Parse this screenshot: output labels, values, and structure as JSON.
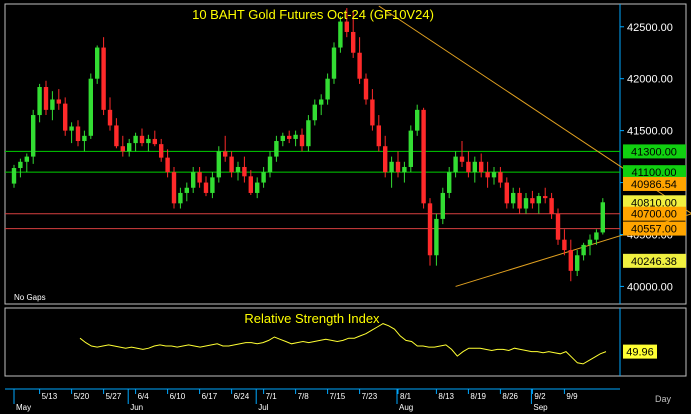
{
  "colors": {
    "background": "#000000",
    "panel_border": "#c0c0c0",
    "axis_blue": "#00a8ff",
    "title": "#ffff00",
    "bull": "#33dd33",
    "bear": "#ff2a2a",
    "trend": "#e0a020",
    "green_level": "#00d000",
    "red_level": "#d84040",
    "rsi_line": "#ffff33",
    "tag_green": "#10d010",
    "tag_orange": "#ffa500",
    "tag_yellow": "#f0f040"
  },
  "chart_data": [
    {
      "type": "candlestick",
      "title": "10  BAHT  Gold  Futures  Oct-24  (GF10V24)",
      "note": "No  Gaps",
      "ylim": [
        39850,
        42700
      ],
      "yticks": [
        40000,
        40500,
        41000,
        41500,
        42000,
        42500
      ],
      "ytick_labels": [
        "40000.00",
        "40500.00",
        "41000.00",
        "41500.00",
        "42000.00",
        "42500.00"
      ],
      "levels": [
        {
          "value": 41300,
          "label": "41300.00",
          "tag": "green",
          "line": "green_level"
        },
        {
          "value": 41100,
          "label": "41100.00",
          "tag": "green",
          "line": "green_level"
        },
        {
          "value": 40986.54,
          "label": "40986.54",
          "tag": "orange",
          "line": null
        },
        {
          "value": 40810,
          "label": "40810.00",
          "tag": "yellow",
          "line": null
        },
        {
          "value": 40700,
          "label": "40700.00",
          "tag": "orange",
          "line": "red_level"
        },
        {
          "value": 40557,
          "label": "40557.00",
          "tag": "orange",
          "line": "red_level"
        },
        {
          "value": 40246.38,
          "label": "40246.38",
          "tag": "yellow",
          "line": null
        }
      ],
      "trendlines": [
        {
          "from": [
            57,
            42700
          ],
          "to": [
            112,
            40450
          ]
        },
        {
          "from": [
            69,
            40000
          ],
          "to": [
            121,
            40986
          ]
        }
      ],
      "candles": [
        [
          40990,
          41170,
          40950,
          41140
        ],
        [
          41140,
          41230,
          41050,
          41200
        ],
        [
          41200,
          41280,
          41100,
          41250
        ],
        [
          41250,
          41700,
          41180,
          41650
        ],
        [
          41650,
          41950,
          41580,
          41920
        ],
        [
          41920,
          41980,
          41650,
          41700
        ],
        [
          41700,
          41880,
          41600,
          41800
        ],
        [
          41800,
          41900,
          41700,
          41760
        ],
        [
          41760,
          41820,
          41450,
          41500
        ],
        [
          41500,
          41580,
          41380,
          41540
        ],
        [
          41540,
          41600,
          41350,
          41400
        ],
        [
          41400,
          41500,
          41300,
          41450
        ],
        [
          41450,
          42050,
          41420,
          42000
        ],
        [
          42000,
          42320,
          41950,
          42300
        ],
        [
          42300,
          42400,
          41650,
          41700
        ],
        [
          41700,
          41820,
          41500,
          41550
        ],
        [
          41550,
          41620,
          41330,
          41350
        ],
        [
          41350,
          41450,
          41250,
          41300
        ],
        [
          41300,
          41420,
          41250,
          41380
        ],
        [
          41380,
          41480,
          41300,
          41450
        ],
        [
          41450,
          41520,
          41350,
          41380
        ],
        [
          41380,
          41460,
          41300,
          41420
        ],
        [
          41420,
          41500,
          41350,
          41370
        ],
        [
          41370,
          41420,
          41200,
          41240
        ],
        [
          41240,
          41320,
          41050,
          41100
        ],
        [
          41100,
          41150,
          40750,
          40800
        ],
        [
          40800,
          40950,
          40750,
          40900
        ],
        [
          40900,
          41000,
          40820,
          40950
        ],
        [
          40950,
          41150,
          40900,
          41100
        ],
        [
          41100,
          41150,
          40950,
          41000
        ],
        [
          41000,
          41060,
          40870,
          40900
        ],
        [
          40900,
          41100,
          40850,
          41050
        ],
        [
          41050,
          41350,
          41000,
          41300
        ],
        [
          41300,
          41450,
          41200,
          41250
        ],
        [
          41250,
          41300,
          41050,
          41100
        ],
        [
          41100,
          41200,
          41020,
          41150
        ],
        [
          41150,
          41250,
          41000,
          41060
        ],
        [
          41060,
          41120,
          40880,
          40900
        ],
        [
          40900,
          41050,
          40850,
          41000
        ],
        [
          41000,
          41150,
          40950,
          41100
        ],
        [
          41100,
          41300,
          41050,
          41250
        ],
        [
          41250,
          41450,
          41200,
          41400
        ],
        [
          41400,
          41480,
          41350,
          41450
        ],
        [
          41450,
          41500,
          41380,
          41420
        ],
        [
          41420,
          41500,
          41350,
          41460
        ],
        [
          41460,
          41520,
          41300,
          41350
        ],
        [
          41350,
          41650,
          41300,
          41600
        ],
        [
          41600,
          41800,
          41550,
          41750
        ],
        [
          41750,
          41850,
          41650,
          41800
        ],
        [
          41800,
          42050,
          41750,
          42000
        ],
        [
          42000,
          42350,
          41950,
          42300
        ],
        [
          42300,
          42600,
          42250,
          42550
        ],
        [
          42550,
          42680,
          42400,
          42450
        ],
        [
          42450,
          42650,
          42200,
          42250
        ],
        [
          42250,
          42400,
          41950,
          42000
        ],
        [
          42000,
          42050,
          41750,
          41800
        ],
        [
          41800,
          41900,
          41500,
          41550
        ],
        [
          41550,
          41650,
          41300,
          41350
        ],
        [
          41350,
          41450,
          41050,
          41100
        ],
        [
          41100,
          41250,
          40950,
          41200
        ],
        [
          41200,
          41300,
          41050,
          41100
        ],
        [
          41100,
          41200,
          41000,
          41150
        ],
        [
          41150,
          41550,
          41100,
          41500
        ],
        [
          41500,
          41750,
          41450,
          41700
        ],
        [
          41700,
          41720,
          40750,
          40800
        ],
        [
          40800,
          40850,
          40200,
          40300
        ],
        [
          40300,
          40700,
          40200,
          40650
        ],
        [
          40650,
          40950,
          40600,
          40900
        ],
        [
          40900,
          41150,
          40850,
          41100
        ],
        [
          41100,
          41300,
          41050,
          41250
        ],
        [
          41250,
          41400,
          41150,
          41200
        ],
        [
          41200,
          41300,
          41050,
          41100
        ],
        [
          41100,
          41250,
          41000,
          41200
        ],
        [
          41200,
          41280,
          41050,
          41100
        ],
        [
          41100,
          41200,
          40950,
          41050
        ],
        [
          41050,
          41150,
          40980,
          41100
        ],
        [
          41100,
          41150,
          40950,
          41000
        ],
        [
          41000,
          41050,
          40750,
          40800
        ],
        [
          40800,
          40950,
          40750,
          40900
        ],
        [
          40900,
          40950,
          40700,
          40750
        ],
        [
          40750,
          40900,
          40700,
          40850
        ],
        [
          40850,
          40920,
          40750,
          40800
        ],
        [
          40800,
          40900,
          40700,
          40870
        ],
        [
          40870,
          40950,
          40800,
          40850
        ],
        [
          40850,
          40900,
          40650,
          40700
        ],
        [
          40700,
          40750,
          40400,
          40450
        ],
        [
          40450,
          40550,
          40300,
          40350
        ],
        [
          40350,
          40450,
          40050,
          40150
        ],
        [
          40150,
          40350,
          40100,
          40300
        ],
        [
          40300,
          40420,
          40250,
          40400
        ],
        [
          40400,
          40500,
          40300,
          40450
        ],
        [
          40450,
          40550,
          40400,
          40520
        ],
        [
          40520,
          40850,
          40500,
          40810
        ]
      ]
    },
    {
      "type": "line",
      "title": "Relative  Strength  Index",
      "current_label": "49.96",
      "ylim": [
        30,
        80
      ],
      "values": [
        62,
        58,
        55,
        54,
        55,
        56,
        55,
        54,
        53,
        54,
        53,
        52,
        53,
        55,
        56,
        55,
        55,
        54,
        55,
        56,
        55,
        54,
        55,
        56,
        57,
        55,
        55,
        56,
        57,
        58,
        58,
        57,
        58,
        60,
        63,
        61,
        59,
        57,
        58,
        59,
        58,
        59,
        60,
        61,
        60,
        59,
        60,
        62,
        62,
        64,
        66,
        69,
        72,
        75,
        73,
        70,
        64,
        60,
        59,
        55,
        55,
        54,
        54,
        55,
        56,
        52,
        46,
        50,
        53,
        53,
        53,
        52,
        51,
        52,
        52,
        51,
        53,
        52,
        51,
        50,
        50,
        49,
        50,
        49,
        48,
        50,
        45,
        40,
        39,
        42,
        45,
        48,
        50
      ]
    }
  ],
  "x_axis": {
    "date_labels": [
      {
        "i": 4,
        "label": "5/13"
      },
      {
        "i": 9,
        "label": "5/20"
      },
      {
        "i": 14,
        "label": "5/27"
      },
      {
        "i": 19,
        "label": "6/4"
      },
      {
        "i": 24,
        "label": "6/10"
      },
      {
        "i": 29,
        "label": "6/17"
      },
      {
        "i": 34,
        "label": "6/24"
      },
      {
        "i": 39,
        "label": "7/1"
      },
      {
        "i": 44,
        "label": "7/8"
      },
      {
        "i": 49,
        "label": "7/15"
      },
      {
        "i": 54,
        "label": "7/23"
      },
      {
        "i": 60,
        "label": "8/1"
      },
      {
        "i": 66,
        "label": "8/13"
      },
      {
        "i": 71,
        "label": "8/19"
      },
      {
        "i": 76,
        "label": "8/26"
      },
      {
        "i": 81,
        "label": "9/2"
      },
      {
        "i": 86,
        "label": "9/9"
      }
    ],
    "month_labels": [
      {
        "i": 0,
        "label": "May"
      },
      {
        "i": 18,
        "label": "Jun"
      },
      {
        "i": 38,
        "label": "Jul"
      },
      {
        "i": 60,
        "label": "Aug"
      },
      {
        "i": 81,
        "label": "Sep"
      }
    ],
    "period_label": "Day"
  }
}
